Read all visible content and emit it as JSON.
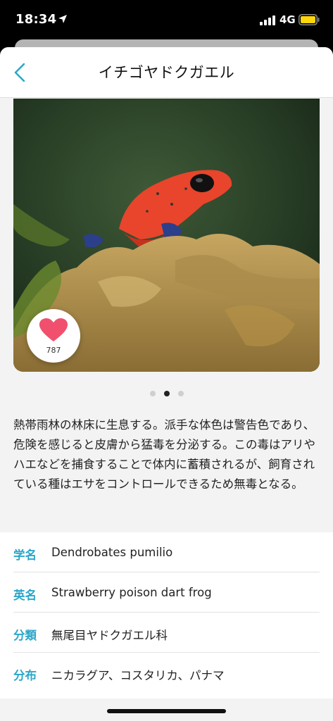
{
  "status_bar": {
    "time": "18:34",
    "network": "4G",
    "battery_color": "#ffd60a"
  },
  "nav": {
    "title": "イチゴヤドクガエル",
    "back_icon": "chevron-left-icon"
  },
  "photo": {
    "subject": "frog",
    "like_count": "787",
    "heart_color": "#f0506e"
  },
  "pager": {
    "count": 3,
    "active_index": 1
  },
  "description": "熱帯雨林の林床に生息する。派手な体色は警告色であり、危険を感じると皮膚から猛毒を分泌する。この毒はアリやハエなどを捕食することで体内に蓄積されるが、飼育されている種はエサをコントロールできるため無毒となる。",
  "info": [
    {
      "label": "学名",
      "value": "Dendrobates pumilio"
    },
    {
      "label": "英名",
      "value": "Strawberry poison dart frog"
    },
    {
      "label": "分類",
      "value": "無尾目ヤドクガエル科"
    },
    {
      "label": "分布",
      "value": "ニカラグア、コスタリカ、パナマ"
    }
  ],
  "accent_color": "#2ba6c9"
}
